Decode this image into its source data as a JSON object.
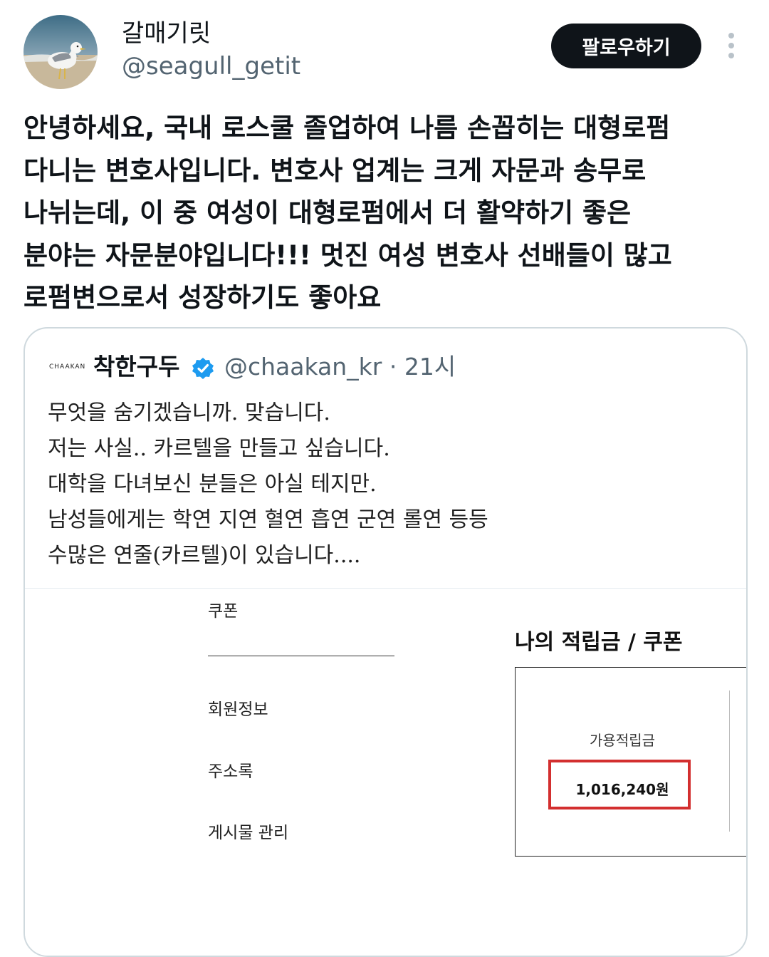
{
  "author": {
    "name": "갈매기릿",
    "handle": "@seagull_getit",
    "follow_label": "팔로우하기"
  },
  "tweet": {
    "lines": [
      "안녕하세요, 국내 로스쿨 졸업하여 나름 손꼽히는 대형로펌",
      "다니는 변호사입니다. 변호사 업계는 크게 자문과 송무로",
      "나뉘는데, 이 중 여성이 대형로펌에서 더 활약하기 좋은",
      "분야는 자문분야입니다!!! 멋진 여성 변호사 선배들이 많고",
      "로펌변으로서 성장하기도 좋아요"
    ]
  },
  "quote": {
    "logo_text": "CHAAKAN",
    "name": "착한구두",
    "meta": "@chaakan_kr · 21시",
    "lines": [
      "무엇을 숨기겠습니까. 맞습니다.",
      "저는 사실.. 카르텔을 만들고 싶습니다.",
      "대학을 다녀보신 분들은 아실 테지만.",
      "남성들에게는 학연 지연 혈연 흡연 군연 롤연 등등",
      "수많은 연줄(카르텔)이 있습니다...."
    ],
    "screenshot": {
      "menu": [
        "쿠폰",
        "회원정보",
        "주소록",
        "게시물 관리"
      ],
      "points_title": "나의 적립금 / 쿠폰",
      "points_label": "가용적립금",
      "points_value": "1,016,240원"
    }
  },
  "colors": {
    "follow_bg": "#0f1419",
    "handle": "#536471",
    "verified": "#1d9bf0",
    "highlight": "#d32f2f"
  },
  "icons": {
    "more": "more-vertical-icon",
    "verified": "verified-badge-icon"
  }
}
